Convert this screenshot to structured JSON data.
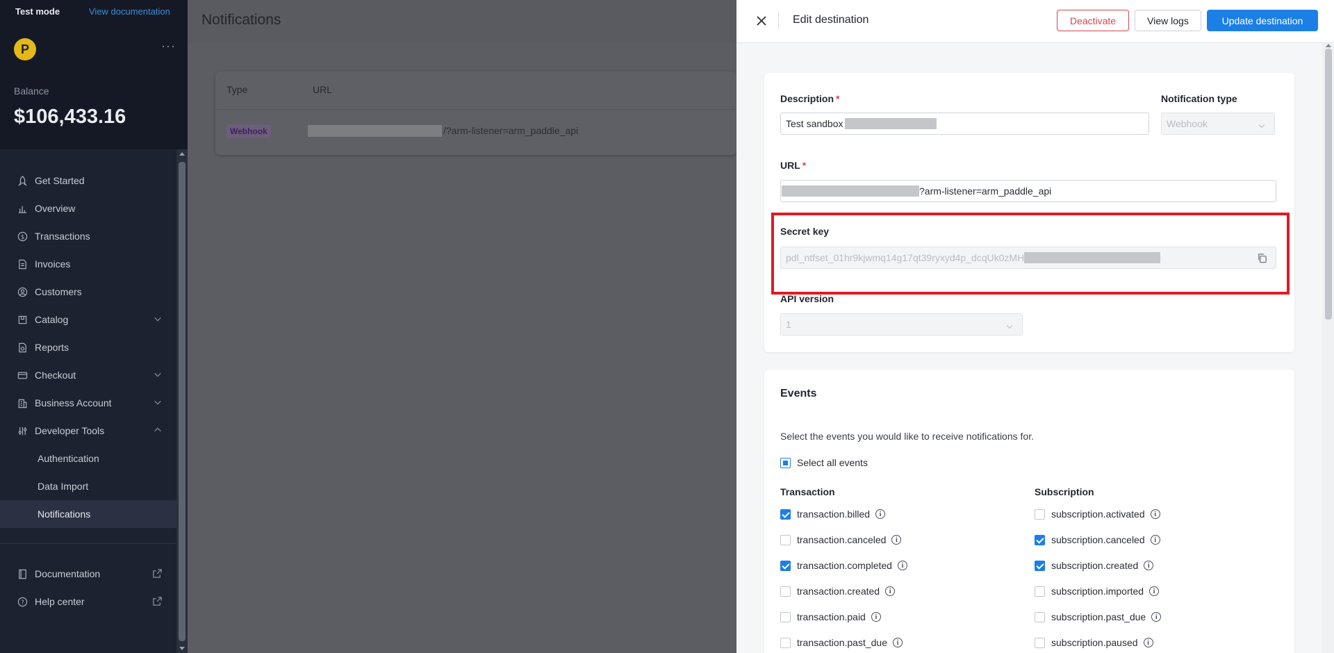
{
  "sidebar": {
    "test_mode": "Test mode",
    "view_documentation": "View documentation",
    "logo_letter": "P",
    "more": "···",
    "balance_label": "Balance",
    "balance_value": "$106,433.16",
    "items": [
      {
        "label": "Get Started",
        "icon": "rocket-icon"
      },
      {
        "label": "Overview",
        "icon": "chart-icon"
      },
      {
        "label": "Transactions",
        "icon": "dollar-circle-icon"
      },
      {
        "label": "Invoices",
        "icon": "document-icon"
      },
      {
        "label": "Customers",
        "icon": "user-circle-icon"
      },
      {
        "label": "Catalog",
        "icon": "box-icon"
      },
      {
        "label": "Reports",
        "icon": "report-icon"
      },
      {
        "label": "Checkout",
        "icon": "card-icon"
      },
      {
        "label": "Business Account",
        "icon": "building-icon"
      },
      {
        "label": "Developer Tools",
        "icon": "sliders-icon"
      }
    ],
    "sub_items": [
      "Authentication",
      "Data Import",
      "Notifications"
    ],
    "bottom_items": [
      {
        "label": "Documentation",
        "icon": "book-icon"
      },
      {
        "label": "Help center",
        "icon": "question-circle-icon"
      }
    ]
  },
  "main": {
    "title": "Notifications",
    "table": {
      "col_type": "Type",
      "col_url": "URL",
      "row_type": "Webhook",
      "row_url_suffix": "/?arm-listener=arm_paddle_api"
    }
  },
  "drawer": {
    "title": "Edit destination",
    "deactivate": "Deactivate",
    "view_logs": "View logs",
    "update": "Update destination",
    "description_label": "Description",
    "description_value": "Test sandbox",
    "notification_type_label": "Notification type",
    "notification_type_value": "Webhook",
    "url_label": "URL",
    "url_suffix": "?arm-listener=arm_paddle_api",
    "secret_key_label": "Secret key",
    "secret_key_value": "pdl_ntfset_01hr9kjwmq14g17qt39ryxyd4p_dcqUk0zMH",
    "api_version_label": "API version",
    "api_version_value": "1",
    "required_mark": "*"
  },
  "events": {
    "title": "Events",
    "description": "Select the events you would like to receive notifications for.",
    "select_all": "Select all events",
    "transaction_title": "Transaction",
    "subscription_title": "Subscription",
    "transaction": [
      {
        "label": "transaction.billed",
        "checked": true
      },
      {
        "label": "transaction.canceled",
        "checked": false
      },
      {
        "label": "transaction.completed",
        "checked": true
      },
      {
        "label": "transaction.created",
        "checked": false
      },
      {
        "label": "transaction.paid",
        "checked": false
      },
      {
        "label": "transaction.past_due",
        "checked": false
      }
    ],
    "subscription": [
      {
        "label": "subscription.activated",
        "checked": false
      },
      {
        "label": "subscription.canceled",
        "checked": true
      },
      {
        "label": "subscription.created",
        "checked": true
      },
      {
        "label": "subscription.imported",
        "checked": false
      },
      {
        "label": "subscription.past_due",
        "checked": false
      },
      {
        "label": "subscription.paused",
        "checked": false
      }
    ]
  },
  "colors": {
    "accent": "#1b7fe6",
    "danger": "#d8464e",
    "sidebar_bg": "#1d2230",
    "highlight": "#e01b24"
  }
}
